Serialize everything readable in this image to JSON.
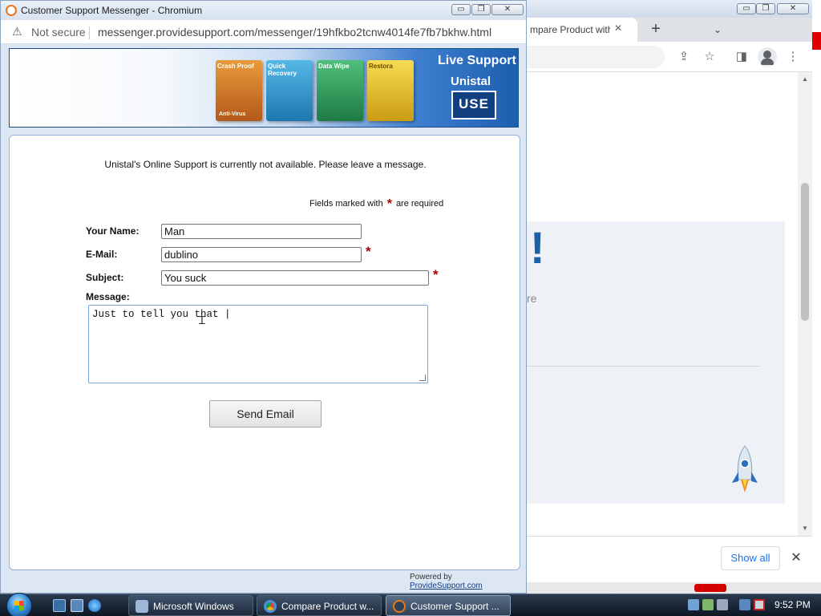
{
  "colors": {
    "accent_blue": "#1a5fa8",
    "required_red": "#b00000",
    "link_blue": "#1a73e8"
  },
  "messenger_window": {
    "title": "Customer Support Messenger - Chromium",
    "app_icon": "providesupport-chat-icon",
    "security_label": "Not secure",
    "security_icon": "warning-triangle-icon",
    "url": "messenger.providesupport.com/messenger/19hfkbo2tcnw4014fe7fb7bkhw.html",
    "controls": {
      "minimize": "▭",
      "maximize": "❐",
      "close": "✕"
    }
  },
  "banner": {
    "live_support": "Live Support",
    "brand": "Unistal",
    "logo_text": "USE",
    "products": [
      {
        "name": "Crash Proof",
        "sub": "Anti-Virus",
        "color": "#d9822b"
      },
      {
        "name": "Quick Recovery",
        "sub": "",
        "color": "#2f9fd5"
      },
      {
        "name": "Data Wipe",
        "sub": "",
        "color": "#2f9a5a"
      },
      {
        "name": "Restora",
        "sub": "",
        "color": "#e4c02a"
      }
    ]
  },
  "form": {
    "notice": "Unistal's Online Support is currently not available. Please leave a message.",
    "required_note_before": "Fields marked with",
    "required_star": "*",
    "required_note_after": "are required",
    "name_label": "Your Name:",
    "name_value": "Man",
    "email_label": "E-Mail:",
    "email_value": "dublino",
    "subject_label": "Subject:",
    "subject_value": "You suck",
    "message_label": "Message:",
    "message_value": "Just to tell you that |",
    "send_label": "Send Email"
  },
  "footer": {
    "powered_by": "Powered by",
    "powered_link": "ProvideSupport.com"
  },
  "back_window": {
    "tab_title": "mpare Product with C",
    "tab_close": "✕",
    "new_tab": "+",
    "tab_search": "⌄",
    "controls": {
      "minimize": "▭",
      "maximize": "❐",
      "close": "✕"
    },
    "share_icon": "⇪",
    "star_icon": "☆",
    "sidebar_icon": "◨",
    "menu_icon": "⋮",
    "exclamation": "!",
    "partial_text": "re",
    "show_all": "Show all",
    "close_downloads": "✕"
  },
  "taskbar": {
    "buttons": [
      {
        "label": "Microsoft Windows",
        "icon": "windows-setup-icon",
        "color": "#9db7d8"
      },
      {
        "label": "Compare Product w...",
        "icon": "chromium-icon",
        "color": "#4a8fe0"
      },
      {
        "label": "Customer Support ...",
        "icon": "providesupport-chat-icon",
        "color": "#e8771c"
      }
    ],
    "clock": "9:52 PM"
  }
}
